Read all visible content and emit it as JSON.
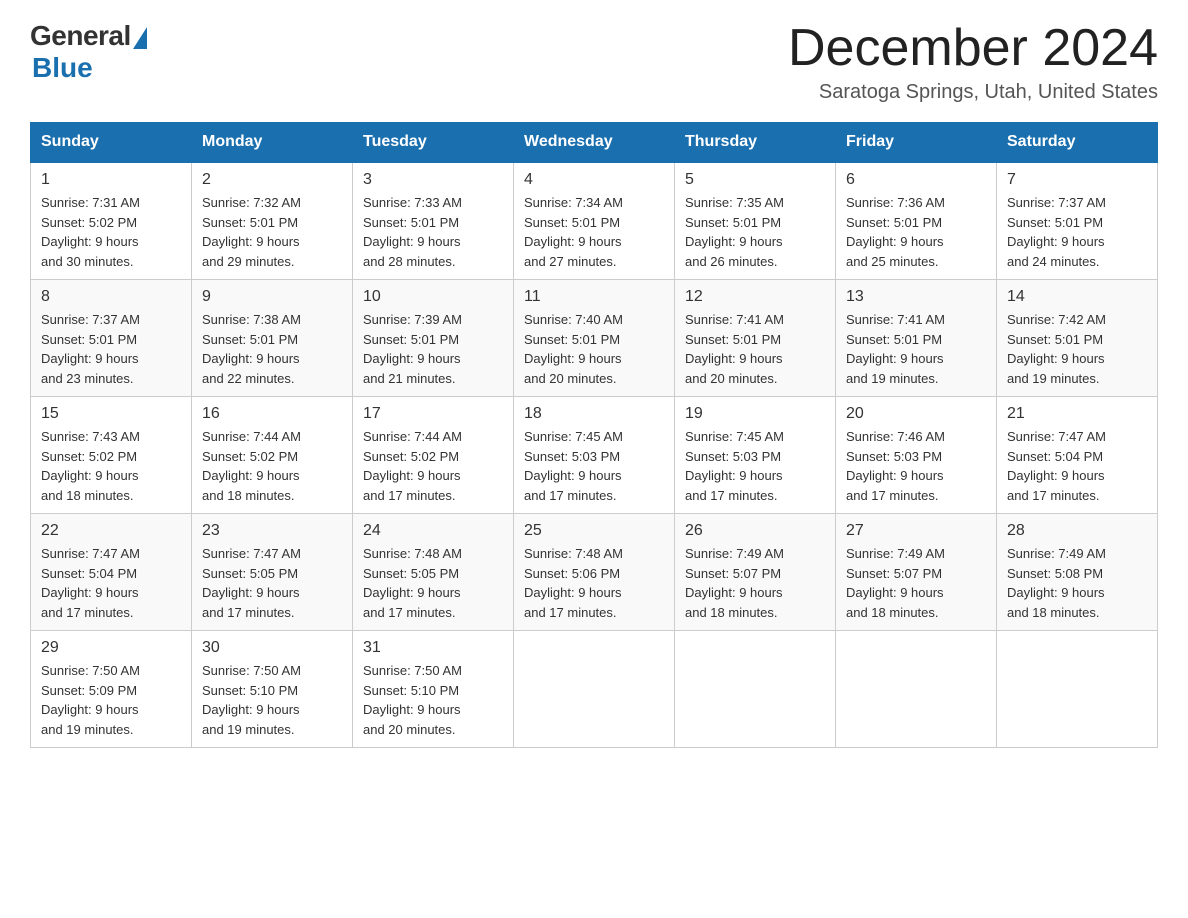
{
  "header": {
    "logo_general": "General",
    "logo_blue": "Blue",
    "month_title": "December 2024",
    "location": "Saratoga Springs, Utah, United States"
  },
  "days_of_week": [
    "Sunday",
    "Monday",
    "Tuesday",
    "Wednesday",
    "Thursday",
    "Friday",
    "Saturday"
  ],
  "weeks": [
    [
      {
        "day": "1",
        "sunrise": "7:31 AM",
        "sunset": "5:02 PM",
        "daylight": "9 hours and 30 minutes."
      },
      {
        "day": "2",
        "sunrise": "7:32 AM",
        "sunset": "5:01 PM",
        "daylight": "9 hours and 29 minutes."
      },
      {
        "day": "3",
        "sunrise": "7:33 AM",
        "sunset": "5:01 PM",
        "daylight": "9 hours and 28 minutes."
      },
      {
        "day": "4",
        "sunrise": "7:34 AM",
        "sunset": "5:01 PM",
        "daylight": "9 hours and 27 minutes."
      },
      {
        "day": "5",
        "sunrise": "7:35 AM",
        "sunset": "5:01 PM",
        "daylight": "9 hours and 26 minutes."
      },
      {
        "day": "6",
        "sunrise": "7:36 AM",
        "sunset": "5:01 PM",
        "daylight": "9 hours and 25 minutes."
      },
      {
        "day": "7",
        "sunrise": "7:37 AM",
        "sunset": "5:01 PM",
        "daylight": "9 hours and 24 minutes."
      }
    ],
    [
      {
        "day": "8",
        "sunrise": "7:37 AM",
        "sunset": "5:01 PM",
        "daylight": "9 hours and 23 minutes."
      },
      {
        "day": "9",
        "sunrise": "7:38 AM",
        "sunset": "5:01 PM",
        "daylight": "9 hours and 22 minutes."
      },
      {
        "day": "10",
        "sunrise": "7:39 AM",
        "sunset": "5:01 PM",
        "daylight": "9 hours and 21 minutes."
      },
      {
        "day": "11",
        "sunrise": "7:40 AM",
        "sunset": "5:01 PM",
        "daylight": "9 hours and 20 minutes."
      },
      {
        "day": "12",
        "sunrise": "7:41 AM",
        "sunset": "5:01 PM",
        "daylight": "9 hours and 20 minutes."
      },
      {
        "day": "13",
        "sunrise": "7:41 AM",
        "sunset": "5:01 PM",
        "daylight": "9 hours and 19 minutes."
      },
      {
        "day": "14",
        "sunrise": "7:42 AM",
        "sunset": "5:01 PM",
        "daylight": "9 hours and 19 minutes."
      }
    ],
    [
      {
        "day": "15",
        "sunrise": "7:43 AM",
        "sunset": "5:02 PM",
        "daylight": "9 hours and 18 minutes."
      },
      {
        "day": "16",
        "sunrise": "7:44 AM",
        "sunset": "5:02 PM",
        "daylight": "9 hours and 18 minutes."
      },
      {
        "day": "17",
        "sunrise": "7:44 AM",
        "sunset": "5:02 PM",
        "daylight": "9 hours and 17 minutes."
      },
      {
        "day": "18",
        "sunrise": "7:45 AM",
        "sunset": "5:03 PM",
        "daylight": "9 hours and 17 minutes."
      },
      {
        "day": "19",
        "sunrise": "7:45 AM",
        "sunset": "5:03 PM",
        "daylight": "9 hours and 17 minutes."
      },
      {
        "day": "20",
        "sunrise": "7:46 AM",
        "sunset": "5:03 PM",
        "daylight": "9 hours and 17 minutes."
      },
      {
        "day": "21",
        "sunrise": "7:47 AM",
        "sunset": "5:04 PM",
        "daylight": "9 hours and 17 minutes."
      }
    ],
    [
      {
        "day": "22",
        "sunrise": "7:47 AM",
        "sunset": "5:04 PM",
        "daylight": "9 hours and 17 minutes."
      },
      {
        "day": "23",
        "sunrise": "7:47 AM",
        "sunset": "5:05 PM",
        "daylight": "9 hours and 17 minutes."
      },
      {
        "day": "24",
        "sunrise": "7:48 AM",
        "sunset": "5:05 PM",
        "daylight": "9 hours and 17 minutes."
      },
      {
        "day": "25",
        "sunrise": "7:48 AM",
        "sunset": "5:06 PM",
        "daylight": "9 hours and 17 minutes."
      },
      {
        "day": "26",
        "sunrise": "7:49 AM",
        "sunset": "5:07 PM",
        "daylight": "9 hours and 18 minutes."
      },
      {
        "day": "27",
        "sunrise": "7:49 AM",
        "sunset": "5:07 PM",
        "daylight": "9 hours and 18 minutes."
      },
      {
        "day": "28",
        "sunrise": "7:49 AM",
        "sunset": "5:08 PM",
        "daylight": "9 hours and 18 minutes."
      }
    ],
    [
      {
        "day": "29",
        "sunrise": "7:50 AM",
        "sunset": "5:09 PM",
        "daylight": "9 hours and 19 minutes."
      },
      {
        "day": "30",
        "sunrise": "7:50 AM",
        "sunset": "5:10 PM",
        "daylight": "9 hours and 19 minutes."
      },
      {
        "day": "31",
        "sunrise": "7:50 AM",
        "sunset": "5:10 PM",
        "daylight": "9 hours and 20 minutes."
      },
      null,
      null,
      null,
      null
    ]
  ]
}
